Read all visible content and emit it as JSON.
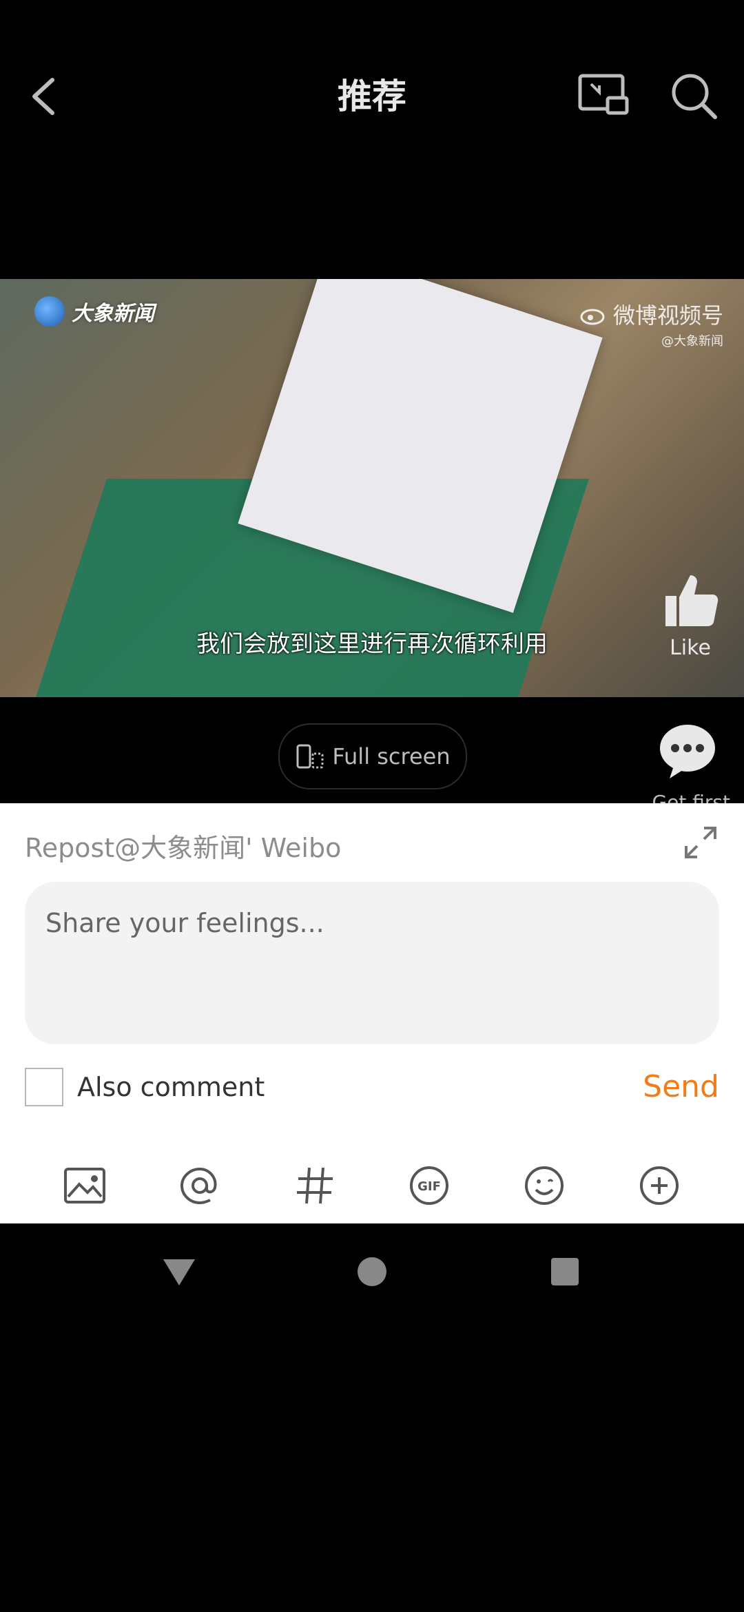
{
  "header": {
    "title": "推荐"
  },
  "video": {
    "watermark_left": "大象新闻",
    "watermark_right_main": "微博视频号",
    "watermark_right_sub": "@大象新闻",
    "subtitle": "我们会放到这里进行再次循环利用",
    "like_label": "Like"
  },
  "controls": {
    "fullscreen_label": "Full screen",
    "get_first_label": "Get first"
  },
  "repost_sheet": {
    "repost_label": "Repost@大象新闻' Weibo",
    "input_placeholder": "Share your feelings...",
    "also_comment_label": "Also comment",
    "also_comment_checked": false,
    "send_label": "Send",
    "send_color": "#f07d1a",
    "toolbar_icons": [
      "image-icon",
      "at-icon",
      "hashtag-icon",
      "gif-icon",
      "emoji-icon",
      "plus-icon"
    ]
  },
  "system_nav": {
    "icons": [
      "back-triangle-icon",
      "home-circle-icon",
      "recents-square-icon"
    ]
  }
}
